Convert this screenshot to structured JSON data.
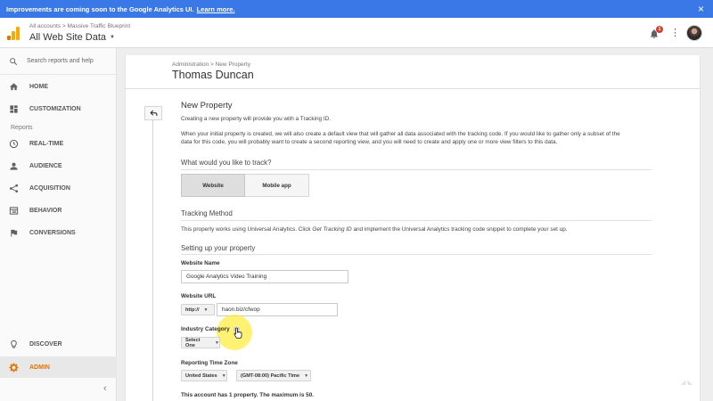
{
  "banner": {
    "text": "Improvements are coming soon to the Google Analytics UI.",
    "link": "Learn more.",
    "close": "×"
  },
  "header": {
    "breadcrumb": "All accounts > Massive Traffic Blueprint",
    "property": "All Web Site Data",
    "caret": "▼",
    "notification_count": "1",
    "menu_glyph": "⋮"
  },
  "sidebar": {
    "search_placeholder": "Search reports and help",
    "reports_label": "Reports",
    "items": [
      {
        "label": "HOME",
        "icon": "home-icon"
      },
      {
        "label": "CUSTOMIZATION",
        "icon": "dashboard-icon"
      },
      {
        "label": "REAL-TIME",
        "icon": "clock-icon"
      },
      {
        "label": "AUDIENCE",
        "icon": "person-icon"
      },
      {
        "label": "ACQUISITION",
        "icon": "acquisition-icon"
      },
      {
        "label": "BEHAVIOR",
        "icon": "behavior-icon"
      },
      {
        "label": "CONVERSIONS",
        "icon": "flag-icon"
      },
      {
        "label": "DISCOVER",
        "icon": "bulb-icon"
      },
      {
        "label": "ADMIN",
        "icon": "gear-icon"
      }
    ],
    "collapse": "‹"
  },
  "page": {
    "breadcrumb": "Administration > New Property",
    "title": "Thomas Duncan"
  },
  "form": {
    "heading": "New Property",
    "intro": "Creating a new property will provide you with a Tracking ID.",
    "desc_1": "When your initial property is created, we will also create a default view that will gather all data associated with the tracking code. If you would like to gather only a subset of the",
    "desc_2": "data for this code, you will probably want to create a second reporting view, and you will need to create and apply one or more view filters to this data.",
    "track_heading": "What would you like to track?",
    "track_options": [
      "Website",
      "Mobile app"
    ],
    "tracking_heading": "Tracking Method",
    "tracking_pre": "This property works using Universal Analytics. Click ",
    "tracking_link": "Get Tracking ID",
    "tracking_post": " and implement the Universal Analytics tracking code snippet to complete your set up.",
    "setup_heading": "Setting up your property",
    "website_name_label": "Website Name",
    "website_name_value": "Google Analytics Video Training",
    "website_url_label": "Website URL",
    "protocol": "http://",
    "url_value": "haon.biz/cfwop",
    "industry_label": "Industry Category",
    "industry_value": "Select One",
    "timezone_label": "Reporting Time Zone",
    "country": "United States",
    "timezone": "(GMT-08:00) Pacific Time",
    "footer": "This account has 1 property. The maximum is 50."
  },
  "colors": {
    "banner": "#3b78e7",
    "admin": "#e37400",
    "badge": "#d23f31",
    "highlight": "#ffeb3b"
  }
}
